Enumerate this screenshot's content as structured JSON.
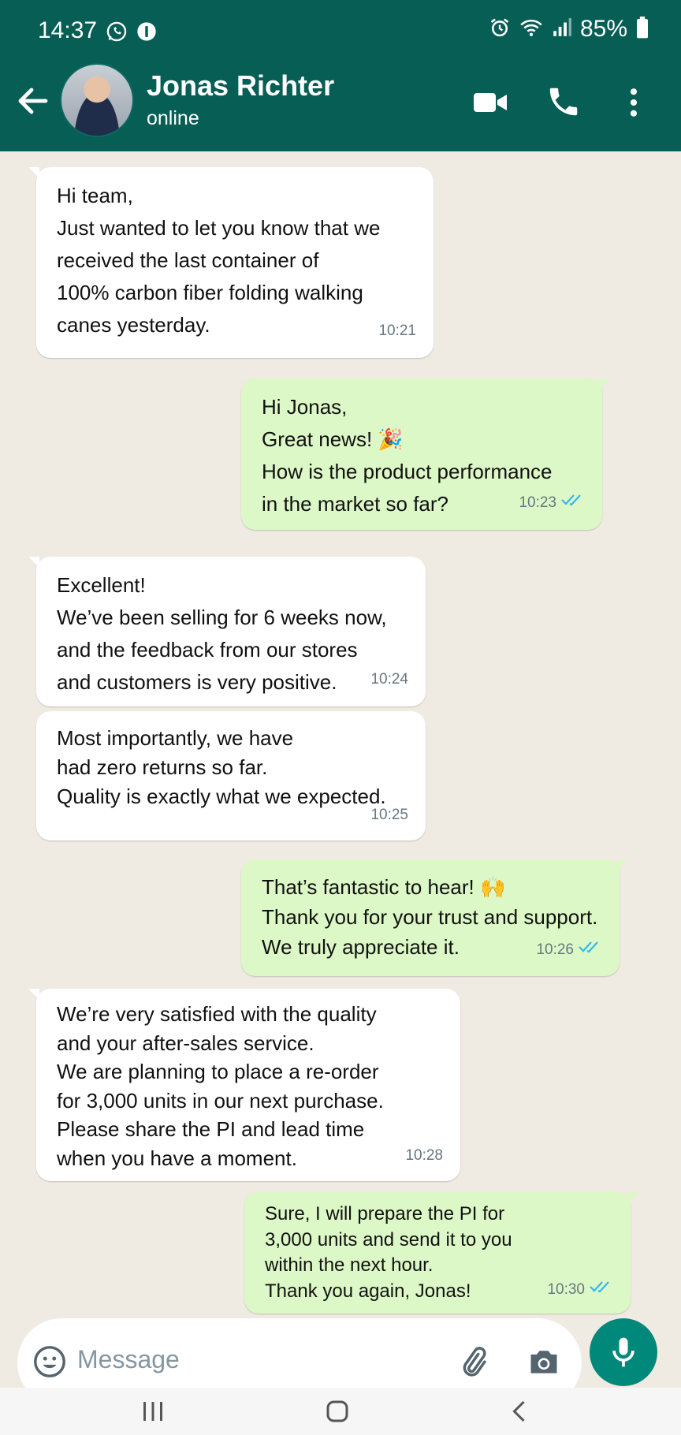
{
  "status_bar": {
    "time": "14:37",
    "battery": "85%"
  },
  "header": {
    "contact_name": "Jonas Richter",
    "contact_status": "online"
  },
  "messages": [
    {
      "dir": "in",
      "text": "Hi team,\nJust wanted to let you know that we\nreceived the last container of\n100% carbon fiber folding walking\ncanes yesterday.",
      "time": "10:21"
    },
    {
      "dir": "out",
      "text": "Hi Jonas,\nGreat news! 🎉\nHow is the product performance\nin the market so far?",
      "time": "10:23",
      "ticks": "read"
    },
    {
      "dir": "in",
      "text": "Excellent!\nWe’ve been selling for 6 weeks now,\nand the feedback from our stores\nand customers is very positive.",
      "time": "10:24"
    },
    {
      "dir": "in",
      "text": "Most importantly, we have\nhad zero returns so far.\nQuality is exactly what we expected.",
      "time": "10:25"
    },
    {
      "dir": "out",
      "text": "That’s fantastic to hear! 🙌\nThank you for your trust and support.\nWe truly appreciate it.",
      "time": "10:26",
      "ticks": "read"
    },
    {
      "dir": "in",
      "text": "We’re very satisfied with the quality\nand your after-sales service.\nWe are planning to place a re-order\nfor 3,000 units in our next purchase.\nPlease share the PI and lead time\nwhen you have a moment.",
      "time": "10:28"
    },
    {
      "dir": "out",
      "text": "Sure, I will prepare the PI for\n3,000 units and send it to you\nwithin the next hour.\nThank you again, Jonas!",
      "time": "10:30",
      "ticks": "read"
    }
  ],
  "composer": {
    "placeholder": "Message"
  },
  "colors": {
    "header": "#075e54",
    "outgoing_bubble": "#dcf8c6",
    "incoming_bubble": "#ffffff",
    "read_ticks": "#34b7f1",
    "mic_button": "#00897b"
  }
}
